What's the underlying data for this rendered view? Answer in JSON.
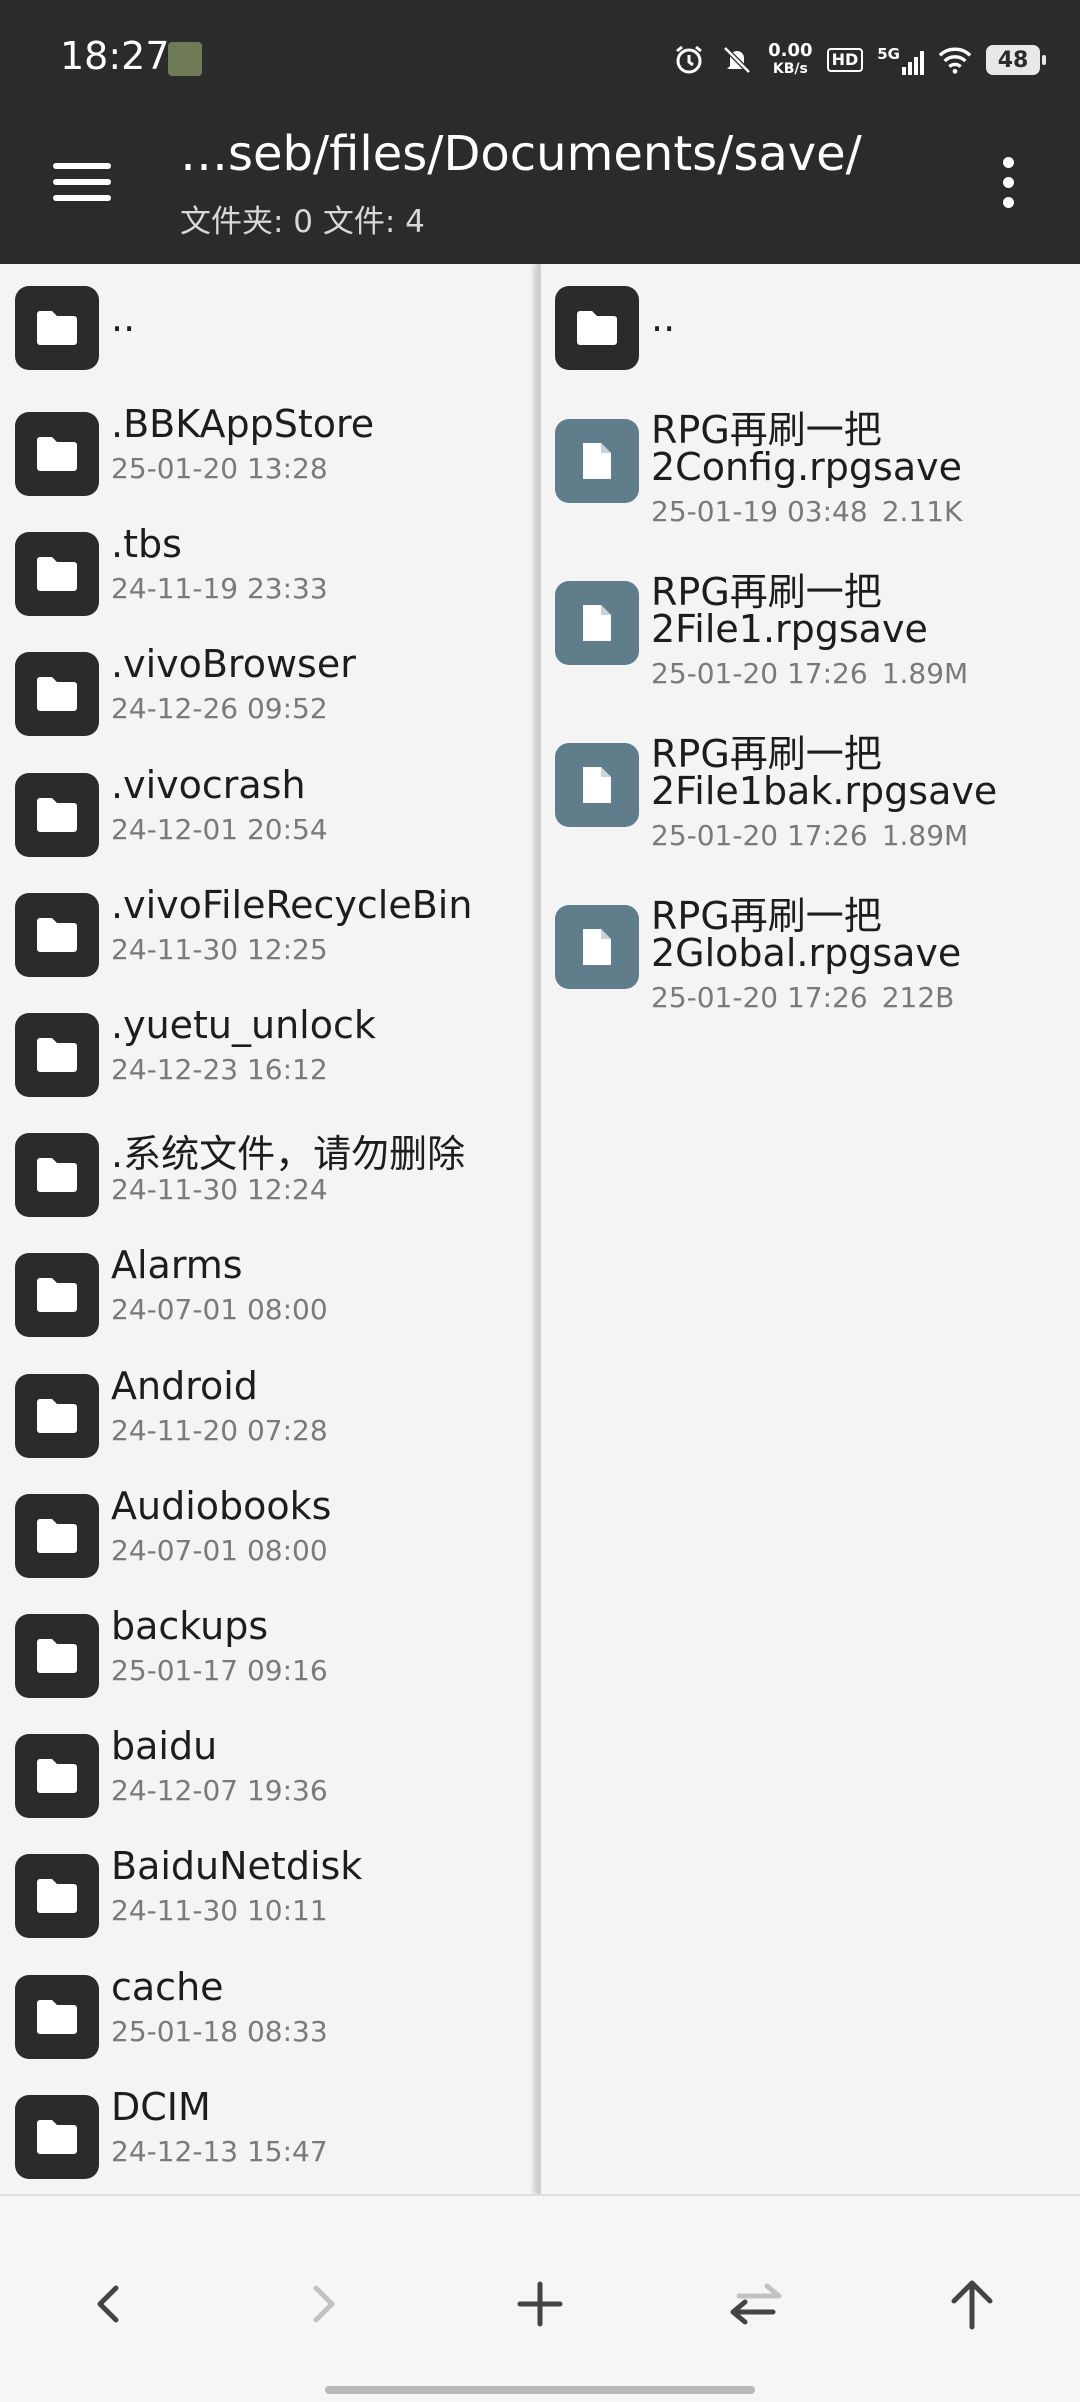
{
  "status_bar": {
    "time": "18:27",
    "net_speed_value": "0.00",
    "net_speed_unit": "KB/s",
    "hd_label": "HD",
    "network_label": "5G",
    "battery_level": "48",
    "icons": [
      "gallery-thumb-icon",
      "alarm-icon",
      "mute-icon",
      "hd-icon",
      "signal-icon",
      "wifi-icon",
      "battery-icon"
    ]
  },
  "app_bar": {
    "path": "…seb/files/Documents/save/",
    "counts": "文件夹: 0  文件: 4"
  },
  "left_pane": {
    "parent_label": "..",
    "items": [
      {
        "name": ".BBKAppStore",
        "date": "25-01-20 13:28"
      },
      {
        "name": ".tbs",
        "date": "24-11-19 23:33"
      },
      {
        "name": ".vivoBrowser",
        "date": "24-12-26 09:52"
      },
      {
        "name": ".vivocrash",
        "date": "24-12-01 20:54"
      },
      {
        "name": ".vivoFileRecycleBin",
        "date": "24-11-30 12:25"
      },
      {
        "name": ".yuetu_unlock",
        "date": "24-12-23 16:12"
      },
      {
        "name": ".系统文件，请勿删除",
        "date": "24-11-30 12:24"
      },
      {
        "name": "Alarms",
        "date": "24-07-01 08:00"
      },
      {
        "name": "Android",
        "date": "24-11-20 07:28"
      },
      {
        "name": "Audiobooks",
        "date": "24-07-01 08:00"
      },
      {
        "name": "backups",
        "date": "25-01-17 09:16"
      },
      {
        "name": "baidu",
        "date": "24-12-07 19:36"
      },
      {
        "name": "BaiduNetdisk",
        "date": "24-11-30 10:11"
      },
      {
        "name": "cache",
        "date": "25-01-18 08:33"
      },
      {
        "name": "DCIM",
        "date": "24-12-13 15:47"
      }
    ]
  },
  "right_pane": {
    "parent_label": "..",
    "files": [
      {
        "name_line1": "RPG再刷一把",
        "name_line2": "2Config.rpgsave",
        "date": "25-01-19 03:48",
        "size": "2.11K"
      },
      {
        "name_line1": "RPG再刷一把",
        "name_line2": "2File1.rpgsave",
        "date": "25-01-20 17:26",
        "size": "1.89M"
      },
      {
        "name_line1": "RPG再刷一把",
        "name_line2": "2File1bak.rpgsave",
        "date": "25-01-20 17:26",
        "size": "1.89M"
      },
      {
        "name_line1": "RPG再刷一把",
        "name_line2": "2Global.rpgsave",
        "date": "25-01-20 17:26",
        "size": "212B"
      }
    ]
  },
  "bottom_bar": {
    "buttons": [
      "back-icon",
      "forward-icon",
      "add-icon",
      "swap-icon",
      "up-icon"
    ]
  },
  "colors": {
    "bar_background": "#2b2b2b",
    "folder_icon": "#2b2b2b",
    "file_icon": "#607d8b",
    "pane_background": "#f4f4f4",
    "meta_text": "#7a7a7a"
  }
}
